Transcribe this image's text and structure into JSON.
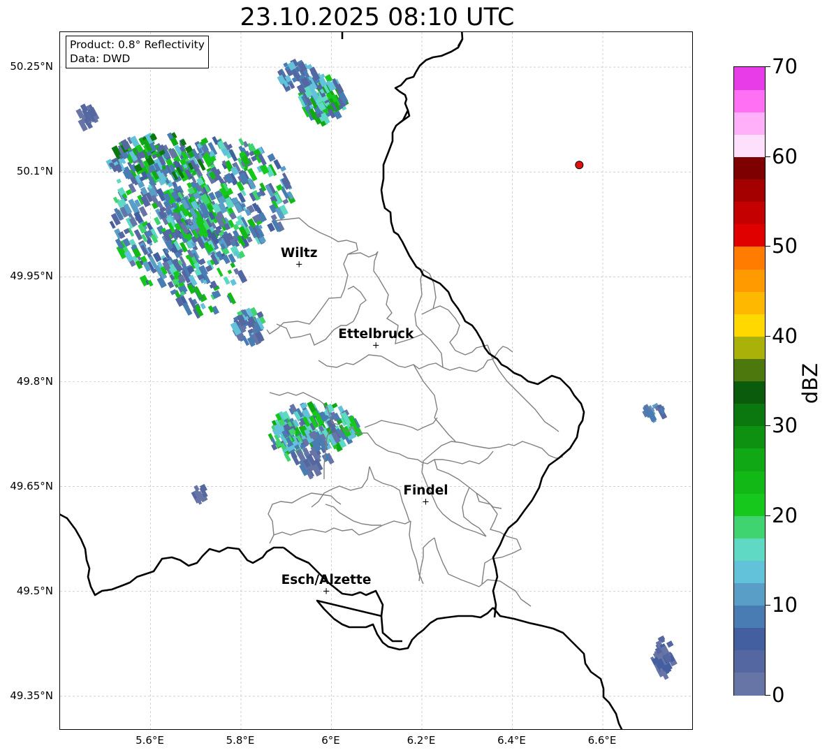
{
  "title": "23.10.2025 08:10 UTC",
  "info_box": {
    "line1": "Product: 0.8° Reflectivity",
    "line2": "Data: DWD"
  },
  "axes": {
    "lat_labels": [
      "50.25°N",
      "50.1°N",
      "49.95°N",
      "49.8°N",
      "49.65°N",
      "49.5°N",
      "49.35°N"
    ],
    "lon_labels": [
      "5.6°E",
      "5.8°E",
      "6°E",
      "6.2°E",
      "6.4°E",
      "6.6°E"
    ],
    "lat_range": [
      49.3,
      50.3
    ],
    "lon_range": [
      5.4,
      6.8
    ]
  },
  "cities": [
    {
      "name": "Wiltz",
      "lon": 5.93,
      "lat": 49.966
    },
    {
      "name": "Ettelbruck",
      "lon": 6.1,
      "lat": 49.85
    },
    {
      "name": "Findel",
      "lon": 6.21,
      "lat": 49.627
    },
    {
      "name": "Esch/Alzette",
      "lon": 5.99,
      "lat": 49.499
    }
  ],
  "marker_icon": "crosshair-icon",
  "radar_site": {
    "lon": 6.548,
    "lat": 50.11,
    "color": "#e01010"
  },
  "colorbar": {
    "unit": "dBZ",
    "min": 0,
    "max": 70,
    "tick_labels": [
      "0",
      "10",
      "20",
      "30",
      "40",
      "50",
      "60",
      "70"
    ],
    "colors": [
      "#6674a6",
      "#5467a0",
      "#445fa0",
      "#4a7cb4",
      "#589ec6",
      "#62c2da",
      "#5fd8c4",
      "#40d470",
      "#16c81c",
      "#12b816",
      "#10a814",
      "#0e9010",
      "#0a780e",
      "#0a5c0c",
      "#4c780e",
      "#aab20a",
      "#ffd800",
      "#ffb800",
      "#ff9a00",
      "#ff7c00",
      "#e00000",
      "#c40000",
      "#a40000",
      "#7e0000",
      "#ffe0fc",
      "#ffb0f8",
      "#ff70f4",
      "#e83ce8"
    ]
  },
  "map_colors": {
    "border": "#000000",
    "canton": "#808080",
    "grid": "#b4b4b4"
  }
}
